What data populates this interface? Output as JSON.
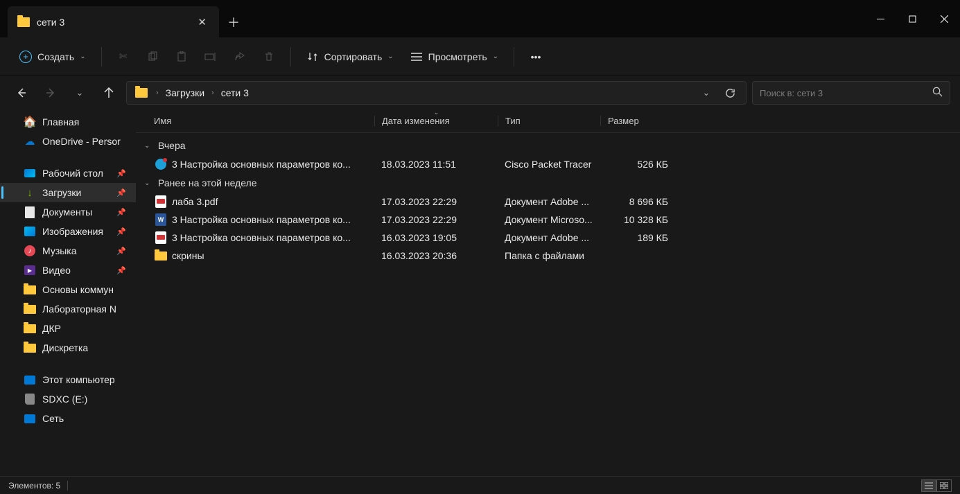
{
  "window": {
    "tab_title": "сети 3"
  },
  "toolbar": {
    "create": "Создать",
    "sort": "Сортировать",
    "view": "Просмотреть"
  },
  "breadcrumb": {
    "seg1": "Загрузки",
    "seg2": "сети 3"
  },
  "search": {
    "placeholder": "Поиск в: сети 3"
  },
  "sidebar": {
    "home": "Главная",
    "onedrive": "OneDrive - Persor",
    "desktop": "Рабочий стол",
    "downloads": "Загрузки",
    "documents": "Документы",
    "pictures": "Изображения",
    "music": "Музыка",
    "videos": "Видео",
    "f1": "Основы коммун",
    "f2": "Лабораторная N",
    "f3": "ДКР",
    "f4": "Дискретка",
    "thispc": "Этот компьютер",
    "sdxc": "SDXC (E:)",
    "network": "Сеть"
  },
  "columns": {
    "name": "Имя",
    "date": "Дата изменения",
    "type": "Тип",
    "size": "Размер"
  },
  "groups": {
    "g1": "Вчера",
    "g2": "Ранее на этой неделе"
  },
  "files": {
    "r1": {
      "name": "3 Настройка основных параметров ко...",
      "date": "18.03.2023 11:51",
      "type": "Cisco Packet Tracer",
      "size": "526 КБ"
    },
    "r2": {
      "name": "лаба 3.pdf",
      "date": "17.03.2023 22:29",
      "type": "Документ Adobe ...",
      "size": "8 696 КБ"
    },
    "r3": {
      "name": "3 Настройка основных параметров ко...",
      "date": "17.03.2023 22:29",
      "type": "Документ Microso...",
      "size": "10 328 КБ"
    },
    "r4": {
      "name": "3 Настройка основных параметров ко...",
      "date": "16.03.2023 19:05",
      "type": "Документ Adobe ...",
      "size": "189 КБ"
    },
    "r5": {
      "name": "скрины",
      "date": "16.03.2023 20:36",
      "type": "Папка с файлами",
      "size": ""
    }
  },
  "statusbar": {
    "count": "Элементов: 5"
  }
}
